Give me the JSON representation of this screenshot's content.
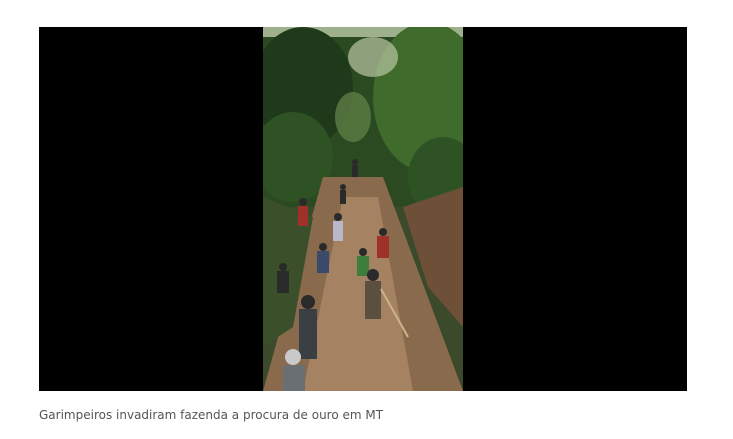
{
  "media": {
    "kind": "video-still",
    "background_color": "#000000",
    "scene_description_icon": "forest-mining-scene"
  },
  "caption": {
    "text": "Garimpeiros invadiram fazenda a procura de ouro em MT"
  },
  "colors": {
    "caption_text": "#555555",
    "foliage_dark": "#1f3a1a",
    "foliage_mid": "#3f6b2c",
    "soil": "#8a6a4c",
    "soil_light": "#b18d6c"
  }
}
